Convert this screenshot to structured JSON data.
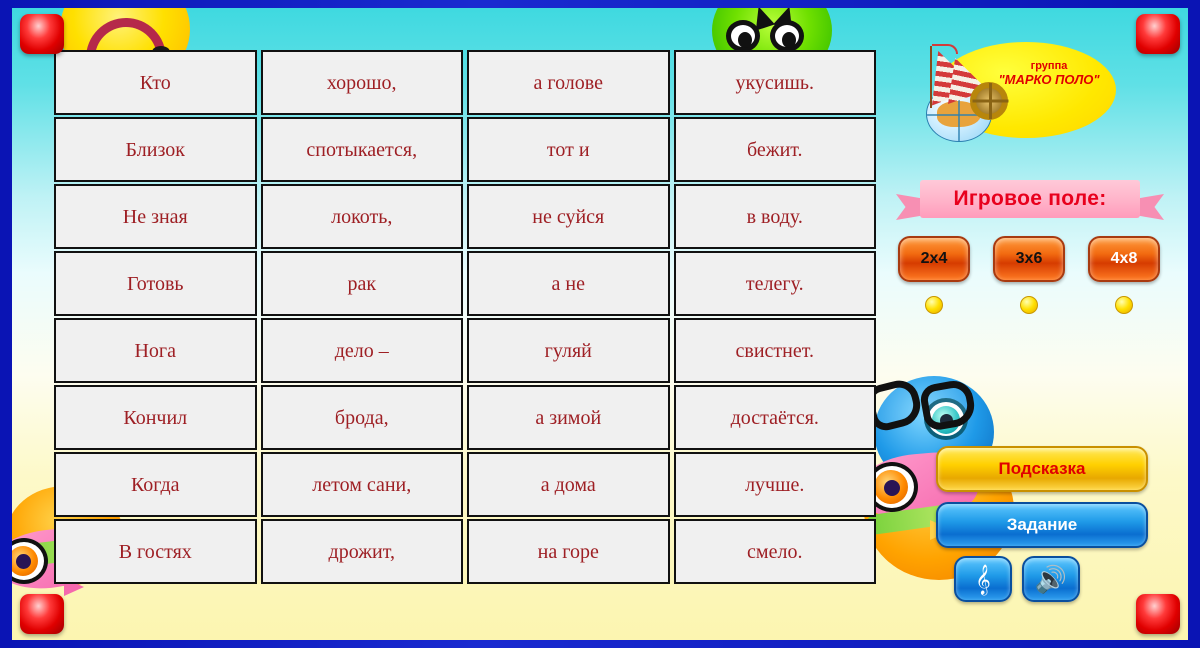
{
  "table": {
    "columns": 4,
    "rows": [
      [
        "Кто",
        "хорошо,",
        "а голове",
        "укусишь."
      ],
      [
        "Близок",
        "спотыкается,",
        "тот и",
        "бежит."
      ],
      [
        "Не зная",
        "локоть,",
        "не суйся",
        "в воду."
      ],
      [
        "Готовь",
        "рак",
        "а не",
        "телегу."
      ],
      [
        "Нога",
        "дело –",
        "гуляй",
        "свистнет."
      ],
      [
        "Кончил",
        "брода,",
        "а зимой",
        "достаётся."
      ],
      [
        "Когда",
        "летом сани,",
        "а дома",
        "лучше."
      ],
      [
        "В гостях",
        "дрожит,",
        "на горе",
        "смело."
      ]
    ]
  },
  "logo": {
    "line1": "группа",
    "line2": "\"МАРКО ПОЛО\""
  },
  "banner": {
    "label": "Игровое поле:"
  },
  "field_buttons": [
    {
      "label": "2x4",
      "selected": false
    },
    {
      "label": "3x6",
      "selected": false
    },
    {
      "label": "4x8",
      "selected": true
    }
  ],
  "actions": {
    "hint_label": "Подсказка",
    "task_label": "Задание",
    "music_icon": "treble-clef-icon",
    "sound_icon": "speaker-icon"
  },
  "colors": {
    "cell_text": "#9e1f24",
    "cell_bg": "#f0f0f0",
    "frame": "#0a14b4",
    "banner_text": "#e8001d",
    "hint_text": "#e00000",
    "field_btn": "#f26a10"
  }
}
